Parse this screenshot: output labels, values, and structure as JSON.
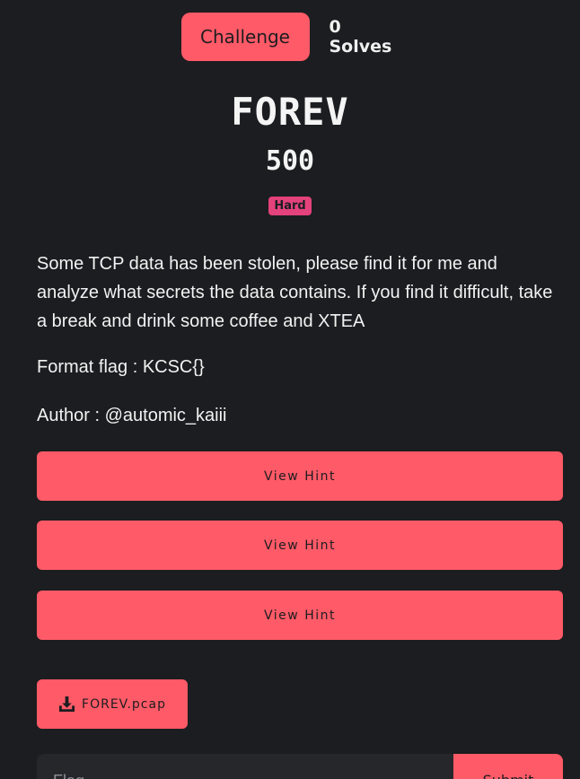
{
  "tabs": {
    "challenge_label": "Challenge",
    "solves_label": "0 Solves"
  },
  "challenge": {
    "name": "FOREV",
    "points": "500",
    "difficulty": "Hard",
    "description": "Some TCP data has been stolen, please find it for me and analyze what secrets the data contains. If you find it difficult, take a break and drink some coffee and XTEA",
    "format_flag": "Format flag : KCSC{}",
    "author": "Author : @automic_kaiii"
  },
  "hints": [
    {
      "label": "View Hint"
    },
    {
      "label": "View Hint"
    },
    {
      "label": "View Hint"
    }
  ],
  "files": [
    {
      "name": "FOREV.pcap",
      "icon": "download-icon"
    }
  ],
  "submission": {
    "placeholder": "Flag",
    "submit_label": "Submit"
  },
  "colors": {
    "background": "#1c1d20",
    "accent": "#ff5a67",
    "badge": "#e3427a"
  }
}
